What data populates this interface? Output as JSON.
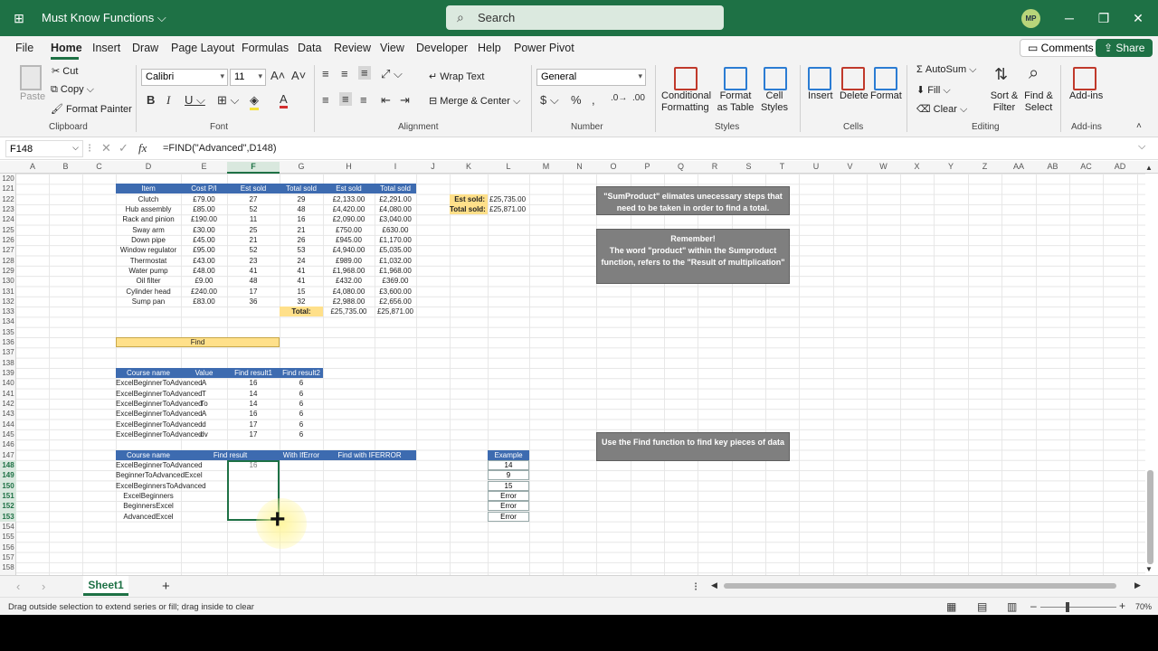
{
  "titlebar": {
    "doc_title": "Must Know Functions ⌵",
    "search_placeholder": "Search",
    "avatar": "MP"
  },
  "tabs": [
    "File",
    "Home",
    "Insert",
    "Draw",
    "Page Layout",
    "Formulas",
    "Data",
    "Review",
    "View",
    "Developer",
    "Help",
    "Power Pivot"
  ],
  "ribbon_buttons": {
    "comments": "Comments",
    "share": "Share"
  },
  "ribbon": {
    "clipboard": {
      "paste": "Paste",
      "cut": "Cut",
      "copy": "Copy",
      "format_painter": "Format Painter",
      "label": "Clipboard"
    },
    "font": {
      "name": "Calibri",
      "size": "11",
      "label": "Font"
    },
    "alignment": {
      "wrap": "Wrap Text",
      "merge": "Merge & Center",
      "label": "Alignment"
    },
    "number": {
      "format": "General",
      "label": "Number"
    },
    "styles": {
      "cond": "Conditional Formatting",
      "table": "Format as Table",
      "cell": "Cell Styles",
      "label": "Styles"
    },
    "cells": {
      "insert": "Insert",
      "delete": "Delete",
      "format": "Format",
      "label": "Cells"
    },
    "editing": {
      "autosum": "AutoSum",
      "fill": "Fill",
      "clear": "Clear",
      "sort": "Sort & Filter",
      "find": "Find & Select",
      "label": "Editing"
    },
    "addins": {
      "addins": "Add-ins",
      "label": "Add-ins"
    }
  },
  "formula_bar": {
    "name_box": "F148",
    "formula": "=FIND(\"Advanced\",D148)"
  },
  "columns": [
    "A",
    "B",
    "C",
    "D",
    "E",
    "F",
    "G",
    "H",
    "I",
    "J",
    "K",
    "L",
    "M",
    "N",
    "O",
    "P",
    "Q",
    "R",
    "S",
    "T",
    "U",
    "V",
    "W",
    "X",
    "Y",
    "Z",
    "AA",
    "AB",
    "AC",
    "AD"
  ],
  "rows": [
    "120",
    "121",
    "122",
    "123",
    "124",
    "125",
    "126",
    "127",
    "128",
    "129",
    "130",
    "131",
    "132",
    "133",
    "134",
    "135",
    "136",
    "137",
    "138",
    "139",
    "140",
    "141",
    "142",
    "143",
    "144",
    "145",
    "146",
    "147",
    "148",
    "149",
    "150",
    "151",
    "152",
    "153",
    "154",
    "155",
    "156",
    "157",
    "158"
  ],
  "table1": {
    "headers": [
      "Item",
      "Cost P/I",
      "Est sold",
      "Total sold",
      "Est sold",
      "Total sold"
    ],
    "rows": [
      [
        "Clutch",
        "£79.00",
        "27",
        "29",
        "£2,133.00",
        "£2,291.00"
      ],
      [
        "Hub assembly",
        "£85.00",
        "52",
        "48",
        "£4,420.00",
        "£4,080.00"
      ],
      [
        "Rack and pinion",
        "£190.00",
        "11",
        "16",
        "£2,090.00",
        "£3,040.00"
      ],
      [
        "Sway arm",
        "£30.00",
        "25",
        "21",
        "£750.00",
        "£630.00"
      ],
      [
        "Down pipe",
        "£45.00",
        "21",
        "26",
        "£945.00",
        "£1,170.00"
      ],
      [
        "Window regulator",
        "£95.00",
        "52",
        "53",
        "£4,940.00",
        "£5,035.00"
      ],
      [
        "Thermostat",
        "£43.00",
        "23",
        "24",
        "£989.00",
        "£1,032.00"
      ],
      [
        "Water pump",
        "£48.00",
        "41",
        "41",
        "£1,968.00",
        "£1,968.00"
      ],
      [
        "Oil filter",
        "£9.00",
        "48",
        "41",
        "£432.00",
        "£369.00"
      ],
      [
        "Cylinder head",
        "£240.00",
        "17",
        "15",
        "£4,080.00",
        "£3,600.00"
      ],
      [
        "Sump pan",
        "£83.00",
        "36",
        "32",
        "£2,988.00",
        "£2,656.00"
      ]
    ],
    "total_label": "Total:",
    "total_est": "£25,735.00",
    "total_sold": "£25,871.00"
  },
  "summary": {
    "est_label": "Est sold:",
    "est_value": "£25,735.00",
    "total_label": "Total sold:",
    "total_value": "£25,871.00"
  },
  "find_label": "Find",
  "table2": {
    "headers": [
      "Course name",
      "Value",
      "Find result1",
      "Find result2"
    ],
    "rows": [
      [
        "ExcelBeginnerToAdvanced",
        "A",
        "16",
        "6"
      ],
      [
        "ExcelBeginnerToAdvanced",
        "T",
        "14",
        "6"
      ],
      [
        "ExcelBeginnerToAdvanced",
        "To",
        "14",
        "6"
      ],
      [
        "ExcelBeginnerToAdvanced",
        "A",
        "16",
        "6"
      ],
      [
        "ExcelBeginnerToAdvanced",
        "d",
        "17",
        "6"
      ],
      [
        "ExcelBeginnerToAdvanced",
        "dv",
        "17",
        "6"
      ]
    ]
  },
  "table3": {
    "headers": [
      "Course name",
      "Find result",
      "With IfError",
      "Find with IFERROR"
    ],
    "courses": [
      "ExcelBeginnerToAdvanced",
      "BeginnerToAdvancedExcel",
      "ExcelBeginnersToAdvanced",
      "ExcelBeginners",
      "BeginnersExcel",
      "AdvancedExcel"
    ],
    "first_result": "16"
  },
  "example": {
    "header": "Example",
    "values": [
      "14",
      "9",
      "15",
      "Error",
      "Error",
      "Error"
    ]
  },
  "notes": {
    "sumproduct": "\"SumProduct\" elimates unecessary steps that need to be taken in order to find a total.",
    "remember_title": "Remember!",
    "remember_body": "The word \"product\" within the Sumproduct function, refers to the \"Result of multiplication\"",
    "find": "Use the Find function to find key pieces of data"
  },
  "sheet_tab": "Sheet1",
  "status": {
    "message": "Drag outside selection to extend series or fill; drag inside to clear",
    "zoom": "70%"
  }
}
